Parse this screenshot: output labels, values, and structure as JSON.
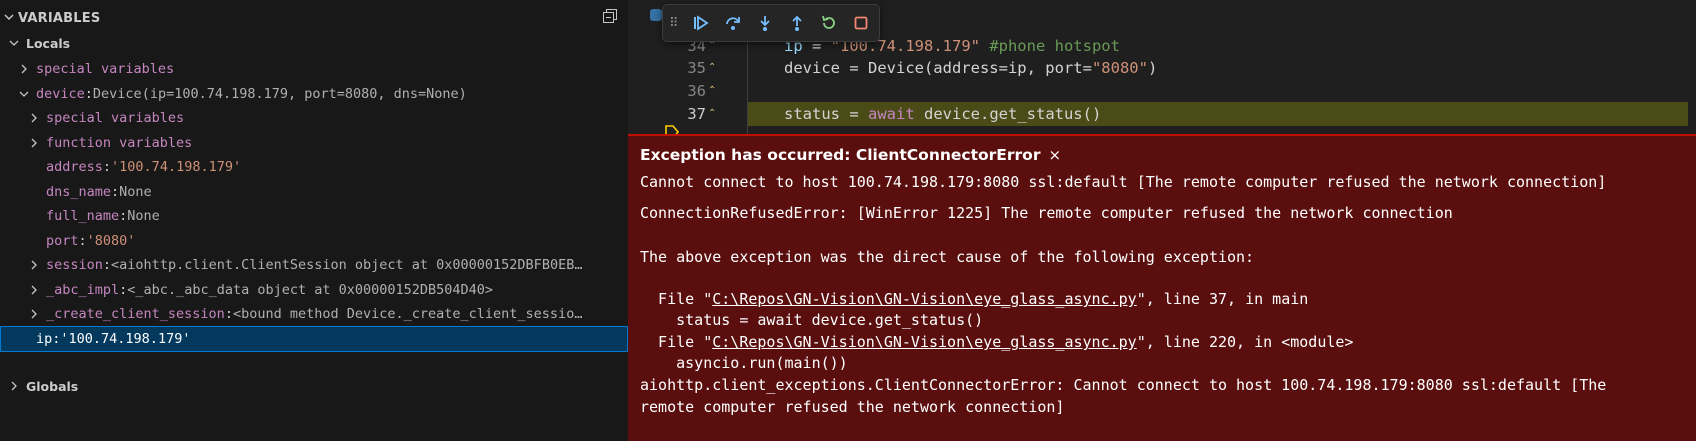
{
  "variables_panel": {
    "title": "VARIABLES",
    "locals_label": "Locals",
    "globals_label": "Globals",
    "rows": [
      {
        "indent": 1,
        "expander": "collapsed",
        "name": "special variables",
        "value": ""
      },
      {
        "indent": 1,
        "expander": "expanded",
        "name": "device",
        "value": "Device(ip=100.74.198.179, port=8080, dns=None)"
      },
      {
        "indent": 2,
        "expander": "collapsed",
        "name": "special variables",
        "value": ""
      },
      {
        "indent": 2,
        "expander": "collapsed",
        "name": "function variables",
        "value": ""
      },
      {
        "indent": 2,
        "expander": "none",
        "name": "address",
        "value": "'100.74.198.179'"
      },
      {
        "indent": 2,
        "expander": "none",
        "name": "dns_name",
        "value": "None"
      },
      {
        "indent": 2,
        "expander": "none",
        "name": "full_name",
        "value": "None"
      },
      {
        "indent": 2,
        "expander": "none",
        "name": "port",
        "value": "'8080'"
      },
      {
        "indent": 2,
        "expander": "collapsed",
        "name": "session",
        "value": "<aiohttp.client.ClientSession object at 0x00000152DBFB0EB…"
      },
      {
        "indent": 2,
        "expander": "collapsed",
        "name": "_abc_impl",
        "value": "<_abc._abc_data object at 0x00000152DB504D40>"
      },
      {
        "indent": 2,
        "expander": "collapsed",
        "name": "_create_client_session",
        "value": "<bound method Device._create_client_sessio…"
      },
      {
        "indent": 1,
        "expander": "none",
        "name": "ip",
        "value": "'100.74.198.179'",
        "selected": true
      }
    ]
  },
  "editor": {
    "lines": [
      {
        "num": "34",
        "code_ip": "ip",
        "code_eq": " = ",
        "code_str": "\"100.74.198.179\"",
        "code_cmt": " #phone hotspot"
      },
      {
        "num": "35",
        "text_a": "device = Device(address=ip, port=",
        "text_str": "\"8080\"",
        "text_b": ")"
      },
      {
        "num": "36"
      },
      {
        "num": "37",
        "text_a": "status = ",
        "text_kw": "await",
        "text_b": " device.get_status()"
      }
    ]
  },
  "exception": {
    "title": "Exception has occurred: ClientConnectorError",
    "close_glyph": "×",
    "message": "Cannot connect to host 100.74.198.179:8080 ssl:default [The remote computer refused the network connection]",
    "cause": "ConnectionRefusedError: [WinError 1225] The remote computer refused the network connection",
    "chain_note": "The above exception was the direct cause of the following exception:",
    "trace": [
      {
        "prefix": "  File \"",
        "path": "C:\\Repos\\GN-Vision\\GN-Vision\\eye_glass_async.py",
        "suffix": "\", line 37, in main",
        "code": "    status = await device.get_status()"
      },
      {
        "prefix": "  File \"",
        "path": "C:\\Repos\\GN-Vision\\GN-Vision\\eye_glass_async.py",
        "suffix": "\", line 220, in <module>",
        "code": "    asyncio.run(main())"
      }
    ],
    "final_1": "aiohttp.client_exceptions.ClientConnectorError: Cannot connect to host 100.74.198.179:8080 ssl:default [The",
    "final_2": "remote computer refused the network connection]"
  }
}
